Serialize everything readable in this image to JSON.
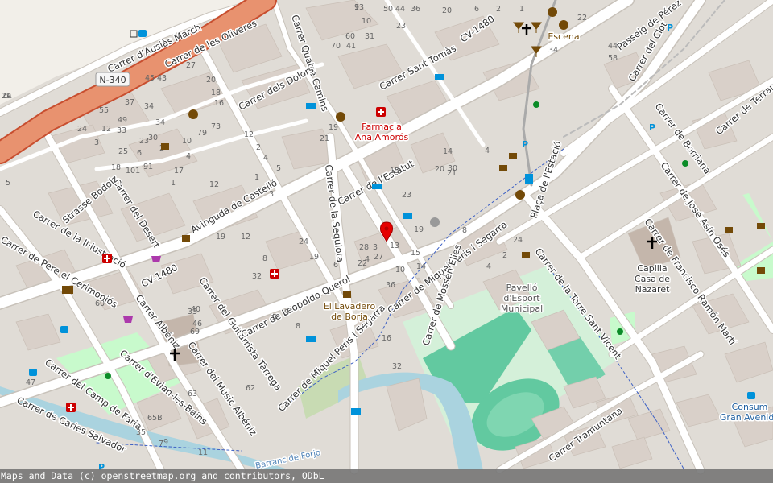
{
  "attribution": "Maps and Data (c) openstreetmap.org and contributors, ODbL",
  "marker": {
    "label": "location-marker"
  },
  "road_shields": [
    {
      "text": "N-340"
    }
  ],
  "streets": [
    "Carrer d'Ausiàs March",
    "Carrer de les Oliveres",
    "Carrer Quatre Camins",
    "Carrer dels Dolors",
    "Carrer Sant Tomàs",
    "CV-1480",
    "Passeig de Pérez",
    "Carrer del Clot",
    "Carrer de Terramar",
    "Carrer de Borriana",
    "Carrer de José Asín Osés",
    "Carrer de Francisco Ramón Martí",
    "Carrer de la Torre Sant Vicent",
    "Plaça de l'Estació",
    "Carrer de l'Estatut",
    "Carrer de Miquel Peris i Segarra",
    "Carrer de la Sequiota",
    "Avinguda de Castelló",
    "Carrer del Desert",
    "Strasse Bodolz",
    "Carrer de la Il·lustració",
    "Carrer de Pere el Cerimoniós",
    "CV-1480",
    "Carrer Albéniz",
    "Carrer d'Evian-les-Bains",
    "Carrer del Camp de Faria",
    "Carrer de Carles Salvador",
    "Carrer del Guitarrista Tàrrega",
    "Carrer del Músic Albéniz",
    "Carrer de Leopoldo Querol",
    "Carrer de Miquel Peris i Segarra",
    "Carrer de Mossèn Elies",
    "Carrer Tramuntana",
    "Barranc de Forjo"
  ],
  "pois": {
    "farmacia": "Farmacia\nAna Amorós",
    "escena": "Escena",
    "lavadero": "El Lavadero\nde Borja",
    "pavello": "Pavelló\nd'Esport\nMunicipal",
    "capilla": "Capilla\nCasa de\nNazaret",
    "consum": "Consum\nGran Avenida"
  },
  "house_numbers": [
    "2A",
    "9",
    "50",
    "44",
    "36",
    "20",
    "6",
    "2",
    "1",
    "10",
    "60",
    "31",
    "70",
    "41",
    "23",
    "45",
    "43",
    "27",
    "20",
    "18",
    "16",
    "55",
    "37",
    "34",
    "49",
    "24",
    "12",
    "34",
    "33",
    "23",
    "30",
    "18",
    "3",
    "6",
    "2",
    "79",
    "73",
    "25",
    "101",
    "91",
    "17",
    "12",
    "5",
    "10",
    "4",
    "1",
    "12",
    "2",
    "4",
    "5",
    "3",
    "1",
    "19",
    "21",
    "15",
    "23",
    "20",
    "21",
    "24",
    "19",
    "12",
    "8",
    "32",
    "14",
    "13",
    "4",
    "10",
    "15",
    "19",
    "3",
    "28",
    "22",
    "27",
    "19",
    "6",
    "8",
    "9",
    "5",
    "46",
    "40",
    "69",
    "63",
    "33",
    "47",
    "35",
    "65B",
    "7",
    "9",
    "11",
    "60",
    "62",
    "16",
    "32",
    "36",
    "24",
    "2",
    "4",
    "8",
    "14",
    "4",
    "30",
    "34",
    "22",
    "44",
    "58",
    "19",
    "13"
  ]
}
